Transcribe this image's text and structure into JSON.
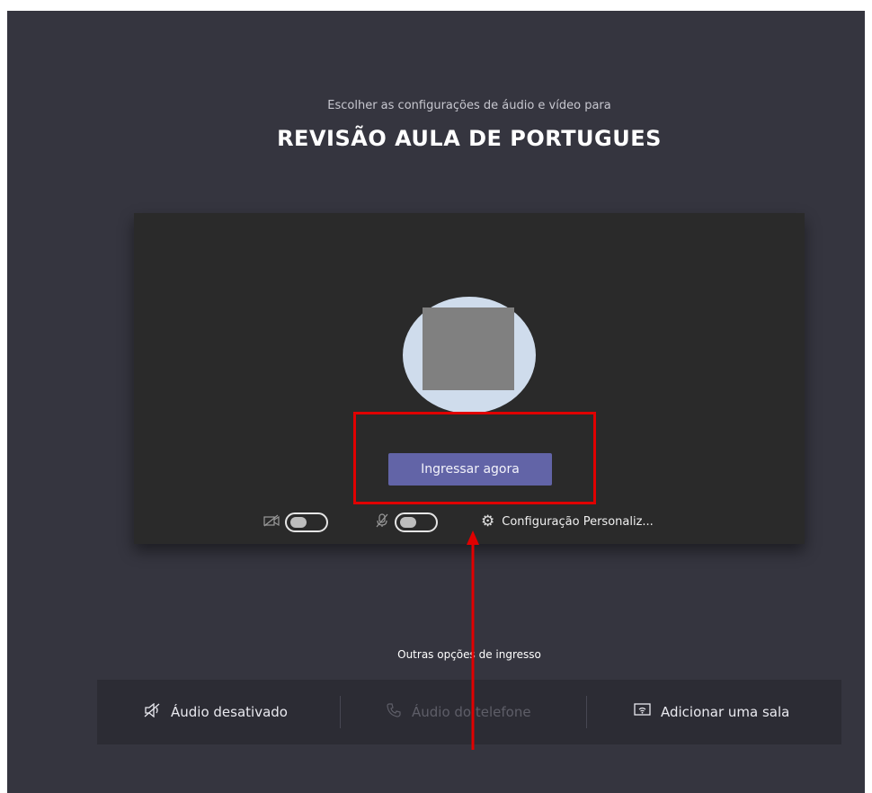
{
  "prejoin": {
    "subtitle": "Escolher as configurações de áudio e vídeo para",
    "meeting_title": "REVISÃO AULA DE PORTUGUES"
  },
  "preview": {
    "join_button_label": "Ingressar agora",
    "camera_toggle": {
      "state": "off",
      "icon": "camera-off-icon"
    },
    "mic_toggle": {
      "state": "off",
      "icon": "mic-off-icon"
    },
    "device_settings_label": "Configuração Personaliz..."
  },
  "other_options": {
    "label": "Outras opções de ingresso",
    "audio_off_label": "Áudio desativado",
    "phone_audio_label": "Áudio do telefone",
    "add_room_label": "Adicionar uma sala"
  },
  "colors": {
    "background": "#35353f",
    "card": "#2a2a2a",
    "accent": "#6264a7",
    "annotation": "#e00000"
  }
}
